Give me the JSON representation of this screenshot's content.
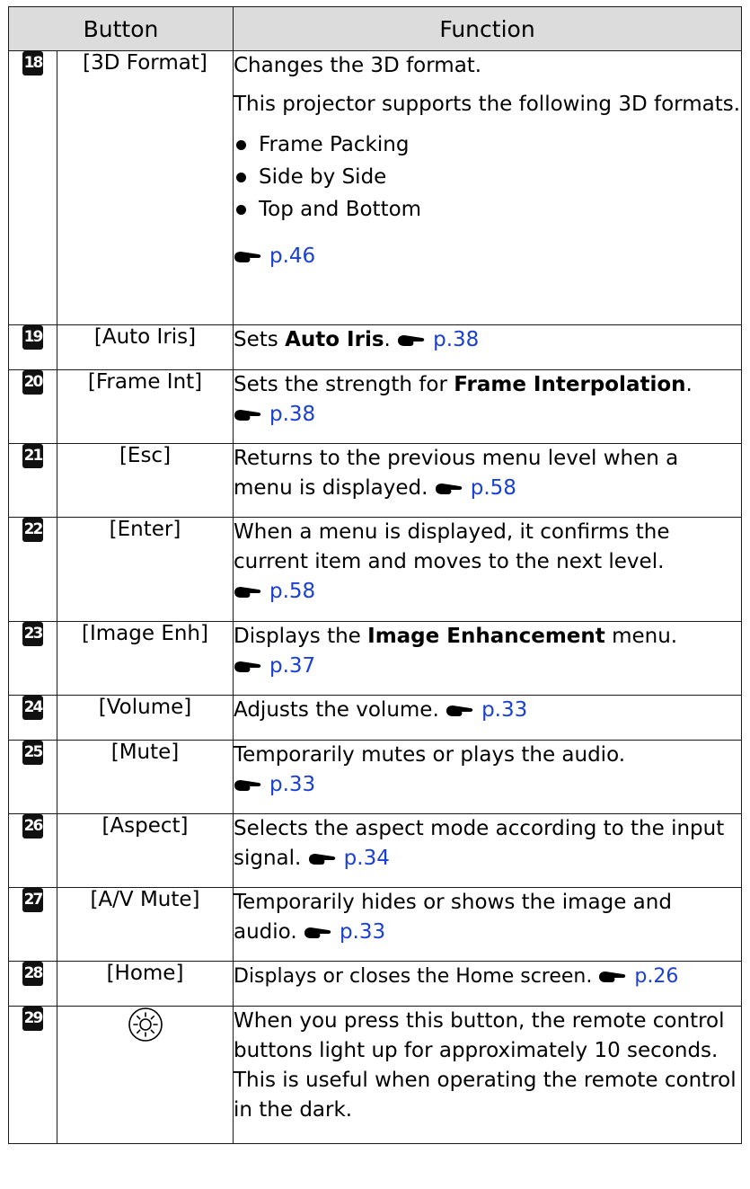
{
  "header": {
    "button": "Button",
    "function": "Function"
  },
  "rows": [
    {
      "num": "18",
      "button": "[3D Format]",
      "p1": "Changes the 3D format.",
      "p2": "This projector supports the following 3D formats.",
      "bullets": [
        "Frame Packing",
        "Side by Side",
        "Top and Bottom"
      ],
      "link": "p.46"
    },
    {
      "num": "19",
      "button": "[Auto Iris]",
      "pre": "Sets ",
      "bold": "Auto Iris",
      "post": ".",
      "link": "p.38"
    },
    {
      "num": "20",
      "button": "[Frame Int]",
      "pre": "Sets the strength for ",
      "bold": "Frame Interpolation",
      "post": ".",
      "link": "p.38"
    },
    {
      "num": "21",
      "button": "[Esc]",
      "text": "Returns to the previous menu level when a menu is displayed.",
      "link": "p.58"
    },
    {
      "num": "22",
      "button": "[Enter]",
      "text": "When a menu is displayed, it confirms the current item and moves to the next level.",
      "link": "p.58"
    },
    {
      "num": "23",
      "button": "[Image Enh]",
      "pre": "Displays the ",
      "bold": "Image Enhancement",
      "post": " menu.",
      "link": "p.37"
    },
    {
      "num": "24",
      "button": "[Volume]",
      "text": "Adjusts the volume.",
      "link": "p.33"
    },
    {
      "num": "25",
      "button": "[Mute]",
      "text": "Temporarily mutes or plays the audio.",
      "link": "p.33"
    },
    {
      "num": "26",
      "button": "[Aspect]",
      "text": "Selects the aspect mode according to the input signal.",
      "link": "p.34"
    },
    {
      "num": "27",
      "button": "[A/V Mute]",
      "text": "Temporarily hides or shows the image and audio.",
      "link": "p.33"
    },
    {
      "num": "28",
      "button": "[Home]",
      "text": "Displays or closes the Home screen.",
      "link": "p.26"
    },
    {
      "num": "29",
      "button_icon": "light-button-icon",
      "text": "When you press this button, the remote control buttons light up for approximately 10 seconds. This is useful when operating the remote control in the dark."
    }
  ],
  "colors": {
    "header_bg": "#dcdcdc",
    "link": "#1a3fd6",
    "badge_bg": "#111111"
  },
  "icons": {
    "reference": "pointing-hand-icon"
  }
}
